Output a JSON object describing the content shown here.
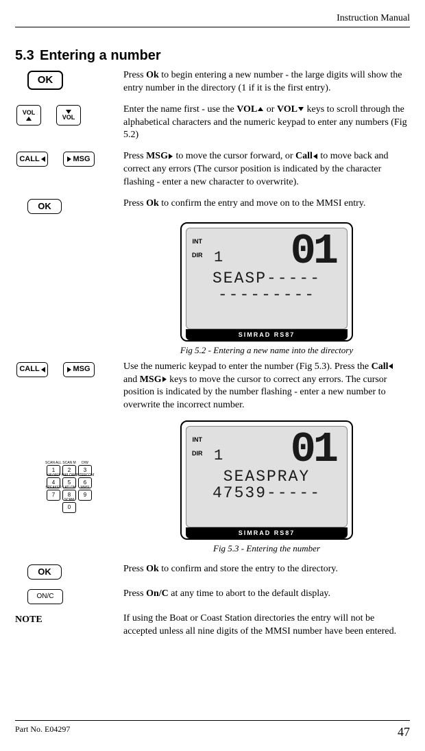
{
  "header": {
    "title": "Instruction Manual"
  },
  "section": {
    "number": "5.3",
    "title": "Entering a number"
  },
  "keys": {
    "ok": "OK",
    "vol": "VOL",
    "call": "CALL",
    "msg": "MSG",
    "onc": "ON/C"
  },
  "paragraphs": {
    "p1a": "Press ",
    "p1b": "Ok",
    "p1c": " to begin entering a new number - the large digits will show the entry number in the directory (1 if it is the first entry).",
    "p2a": "Enter the name first - use the ",
    "p2b": "VOL",
    "p2c": " or ",
    "p2d": "VOL",
    "p2e": " keys to scroll through the alphabetical characters and the numeric keypad to enter any numbers (Fig 5.2)",
    "p3a": "Press ",
    "p3b": "MSG",
    "p3c": " to move the cursor forward, or ",
    "p3d": "Call",
    "p3e": " to move back and correct any errors (The cursor position is indicated by the character flashing - enter a new character to overwrite).",
    "p4a": "Press ",
    "p4b": "Ok",
    "p4c": " to confirm the entry and move on to the MMSI entry.",
    "p5a": "Use the numeric keypad to enter the number (Fig 5.3).  Press the ",
    "p5b": "Call",
    "p5c": " and ",
    "p5d": "MSG",
    "p5e": " keys to move the cursor to correct any errors. The cursor position is indicated by the number flashing - enter a new number to overwrite the incorrect number.",
    "p6a": "Press ",
    "p6b": "Ok",
    "p6c": " to confirm and store the entry to the directory.",
    "p7a": "Press ",
    "p7b": "On/C",
    "p7c": " at any time to abort to the default display.",
    "noteLabel": "NOTE",
    "noteText": "If using the Boat or Coast Station directories the entry will not be accepted unless all nine digits of the MMSI number have been entered."
  },
  "figures": {
    "fig1": {
      "side1": "INT",
      "side2": "DIR",
      "small": "1",
      "big": "01",
      "line1": "SEASP-----",
      "line2": "---------",
      "brand": "SIMRAD RS87",
      "caption": "Fig 5.2 - Entering a new name into the directory"
    },
    "fig2": {
      "side1": "INT",
      "side2": "DIR",
      "small": "1",
      "big": "01",
      "line1": "SEASPRAY",
      "line2": "47539-----",
      "brand": "SIMRAD RS87",
      "caption": "Fig 5.3 - Entering the number"
    }
  },
  "keypad": {
    "labels": [
      "SCAN ALL",
      "SCAN M",
      "D/W",
      "NAV/AFF",
      "HAILOWL",
      "INTERCOM",
      "SPEAKER",
      "LATLON",
      "MMSI",
      "",
      "SCRM",
      ""
    ],
    "digits": [
      "1",
      "2",
      "3",
      "4",
      "5",
      "6",
      "7",
      "8",
      "9",
      "0"
    ]
  },
  "footer": {
    "part": "Part No. E04297",
    "page": "47"
  }
}
